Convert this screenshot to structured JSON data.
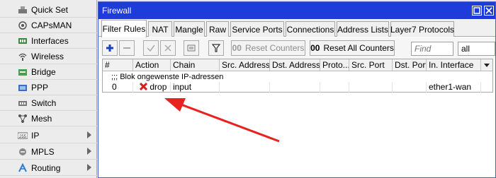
{
  "sidebar": {
    "items": [
      {
        "label": "Quick Set",
        "icon": "quick-set-icon",
        "has_submenu": false
      },
      {
        "label": "CAPsMAN",
        "icon": "capsman-icon",
        "has_submenu": false
      },
      {
        "label": "Interfaces",
        "icon": "interfaces-icon",
        "has_submenu": false
      },
      {
        "label": "Wireless",
        "icon": "wireless-icon",
        "has_submenu": false
      },
      {
        "label": "Bridge",
        "icon": "bridge-icon",
        "has_submenu": false
      },
      {
        "label": "PPP",
        "icon": "ppp-icon",
        "has_submenu": false
      },
      {
        "label": "Switch",
        "icon": "switch-icon",
        "has_submenu": false
      },
      {
        "label": "Mesh",
        "icon": "mesh-icon",
        "has_submenu": false
      },
      {
        "label": "IP",
        "icon": "ip-icon",
        "has_submenu": true
      },
      {
        "label": "MPLS",
        "icon": "mpls-icon",
        "has_submenu": true
      },
      {
        "label": "Routing",
        "icon": "routing-icon",
        "has_submenu": true
      }
    ]
  },
  "window": {
    "title": "Firewall",
    "tabs": [
      {
        "label": "Filter Rules",
        "active": true
      },
      {
        "label": "NAT",
        "active": false
      },
      {
        "label": "Mangle",
        "active": false
      },
      {
        "label": "Raw",
        "active": false
      },
      {
        "label": "Service Ports",
        "active": false
      },
      {
        "label": "Connections",
        "active": false
      },
      {
        "label": "Address Lists",
        "active": false
      },
      {
        "label": "Layer7 Protocols",
        "active": false
      }
    ],
    "toolbar": {
      "reset_counters_label": "Reset Counters",
      "reset_counters_prefix": "00",
      "reset_all_counters_label": "Reset All Counters",
      "reset_all_counters_prefix": "00",
      "find_placeholder": "Find",
      "filter_value": "all"
    },
    "table": {
      "columns": [
        "#",
        "Action",
        "Chain",
        "Src. Address",
        "Dst. Address",
        "Proto...",
        "Src. Port",
        "Dst. Port",
        "In. Interface"
      ],
      "comment": ";;; Blok ongewenste IP-adressen",
      "rows": [
        {
          "num": "0",
          "action": "drop",
          "chain": "input",
          "src_address": "",
          "dst_address": "",
          "proto": "",
          "src_port": "",
          "dst_port": "",
          "in_interface": "ether1-wan"
        }
      ]
    }
  },
  "colors": {
    "titlebar": "#1e3cd9",
    "annotation_arrow": "#e8231f",
    "drop_icon": "#d32020"
  }
}
